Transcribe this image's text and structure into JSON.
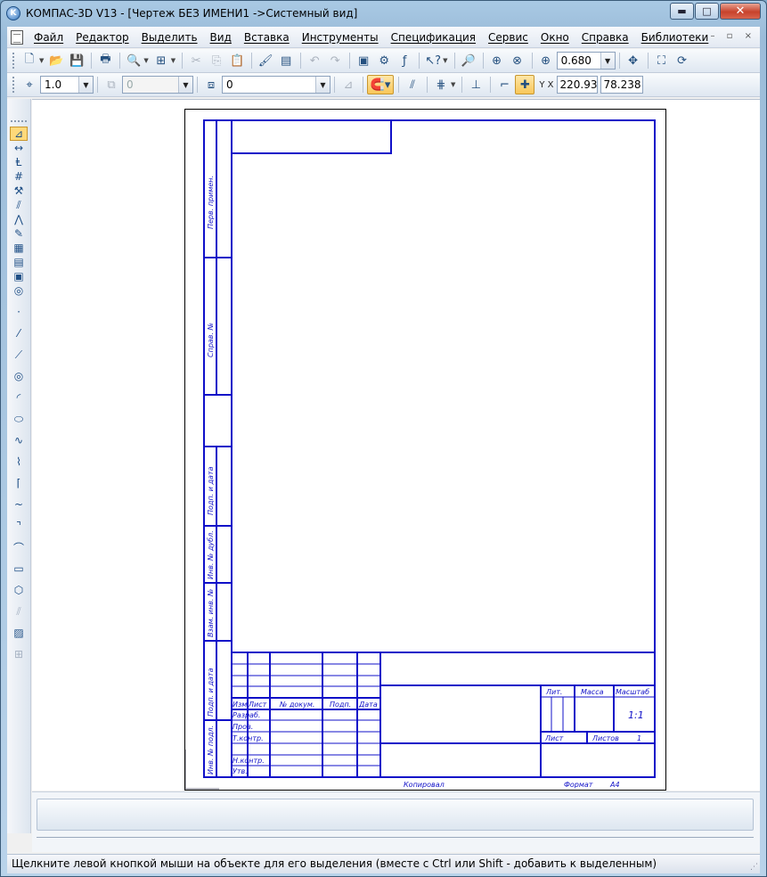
{
  "window": {
    "title": "КОМПАС-3D V13 - [Чертеж БЕЗ ИМЕНИ1 ->Системный вид]",
    "min_glyph": "▬",
    "max_glyph": "□",
    "close_glyph": "✕"
  },
  "menu": {
    "items": [
      "Файл",
      "Редактор",
      "Выделить",
      "Вид",
      "Вставка",
      "Инструменты",
      "Спецификация",
      "Сервис",
      "Окно",
      "Справка",
      "Библиотеки"
    ],
    "mdi_controls": "– ▫ ×"
  },
  "toolbar_main": {
    "zoom_value": "0.680"
  },
  "toolbar_current": {
    "step_value": "1.0",
    "layer_value": "0",
    "style_value": "0",
    "x_value": "220.93",
    "y_value": "78.238",
    "coord_label": "Y X"
  },
  "stamp": {
    "side_labels": [
      "Перв. примен.",
      "Справ. №",
      "Подп. и дата",
      "Инв. № дубл.",
      "Взам. инв. №",
      "Подп. и дата",
      "Инв. № подл."
    ],
    "col_headers": [
      "Изм.",
      "Лист",
      "№ докум.",
      "Подп.",
      "Дата"
    ],
    "row_labels": [
      "Разраб.",
      "Пров.",
      "Т.контр.",
      "Н.контр.",
      "Утв."
    ],
    "lit": "Лит.",
    "massa": "Масса",
    "masshtab": "Масштаб",
    "scale": "1:1",
    "list": "Лист",
    "listov": "Листов",
    "listov_value": "1",
    "kopiroval": "Копировал",
    "format": "Формат",
    "format_value": "А4"
  },
  "status": {
    "text": "Щелкните левой кнопкой мыши на объекте для его выделения (вместе с Ctrl или Shift - добавить к выделенным)"
  }
}
